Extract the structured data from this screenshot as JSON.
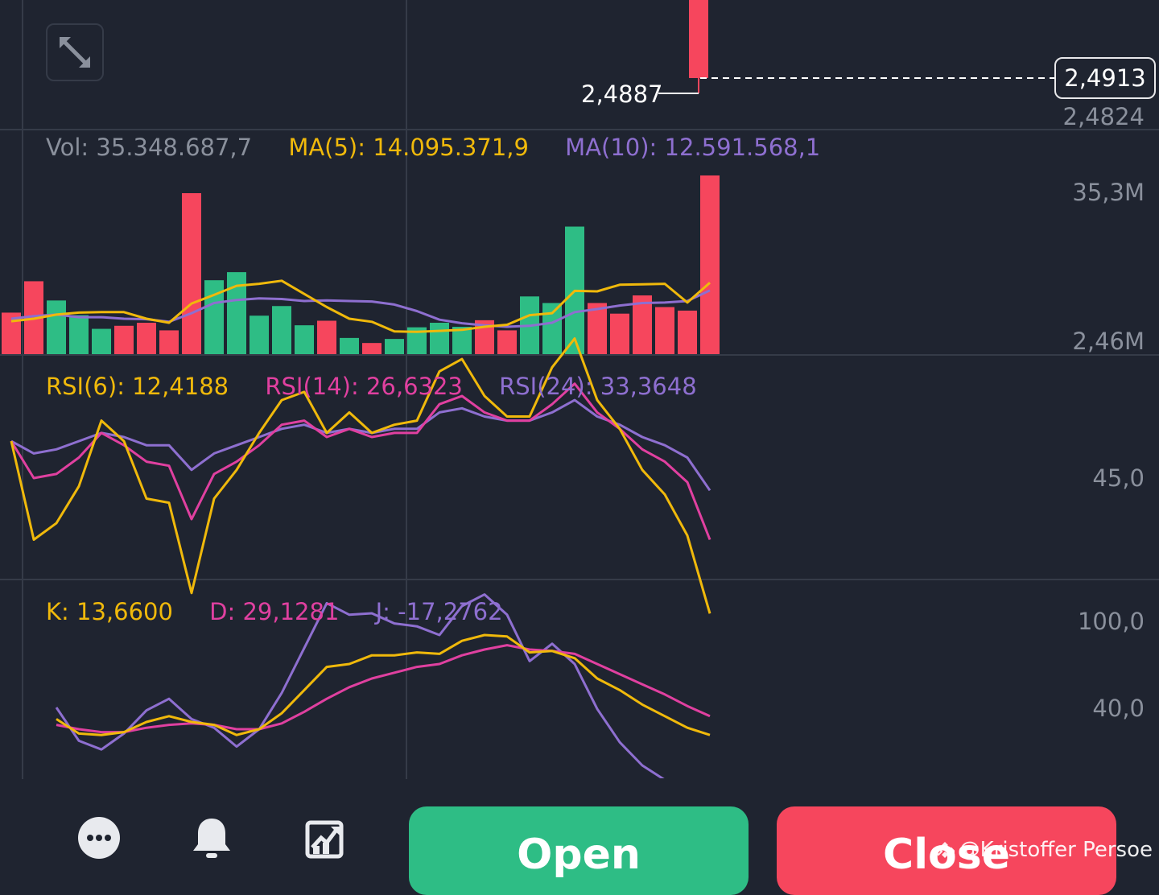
{
  "colors": {
    "background": "#1f2430",
    "grid": "#353b48",
    "up": "#f6465d",
    "down": "#2ebd85",
    "yellow": "#f0b90b",
    "pink": "#e040a0",
    "purple": "#8e6fd0",
    "axis_text": "#8a909c"
  },
  "price": {
    "last_candle_low_label": "2,4887",
    "current_price_tag": "2,4913",
    "axis_label": "2,4824"
  },
  "volume": {
    "legend": {
      "vol": "Vol: 35.348.687,7",
      "ma5": "MA(5): 14.095.371,9",
      "ma10": "MA(10): 12.591.568,1"
    },
    "axis_top": "35,3M",
    "axis_bottom": "2,46M"
  },
  "rsi": {
    "legend": {
      "rsi6": "RSI(6): 12,4188",
      "rsi14": "RSI(14): 26,6323",
      "rsi24": "RSI(24): 33,3648"
    },
    "axis": "45,0"
  },
  "kdj": {
    "legend": {
      "k": "K: 13,6600",
      "d": "D: 29,1281",
      "j": "J: -17,2762"
    },
    "axis_top": "100,0",
    "axis_mid": "40,0"
  },
  "chart_data": {
    "type": "bar",
    "volume_bars": [
      {
        "v": 8.2,
        "up": true
      },
      {
        "v": 14.4,
        "up": true
      },
      {
        "v": 10.6,
        "up": false
      },
      {
        "v": 7.7,
        "up": false
      },
      {
        "v": 5.0,
        "up": false
      },
      {
        "v": 5.6,
        "up": true
      },
      {
        "v": 6.2,
        "up": true
      },
      {
        "v": 4.7,
        "up": true
      },
      {
        "v": 31.8,
        "up": true
      },
      {
        "v": 14.6,
        "up": false
      },
      {
        "v": 16.2,
        "up": false
      },
      {
        "v": 7.6,
        "up": false
      },
      {
        "v": 9.5,
        "up": false
      },
      {
        "v": 5.7,
        "up": false
      },
      {
        "v": 6.6,
        "up": true
      },
      {
        "v": 3.2,
        "up": false
      },
      {
        "v": 2.2,
        "up": true
      },
      {
        "v": 3.0,
        "up": false
      },
      {
        "v": 5.3,
        "up": false
      },
      {
        "v": 6.2,
        "up": false
      },
      {
        "v": 5.4,
        "up": false
      },
      {
        "v": 6.7,
        "up": true
      },
      {
        "v": 4.7,
        "up": true
      },
      {
        "v": 11.4,
        "up": false
      },
      {
        "v": 10.1,
        "up": false
      },
      {
        "v": 25.2,
        "up": false
      },
      {
        "v": 10.1,
        "up": true
      },
      {
        "v": 8.0,
        "up": true
      },
      {
        "v": 11.6,
        "up": true
      },
      {
        "v": 9.3,
        "up": true
      },
      {
        "v": 8.6,
        "up": true
      },
      {
        "v": 35.3,
        "up": true
      }
    ],
    "volume_ma5": [
      6.5,
      7.0,
      7.8,
      8.2,
      8.3,
      8.3,
      7.0,
      6.2,
      10.0,
      11.7,
      13.5,
      13.9,
      14.5,
      11.9,
      9.3,
      7.0,
      6.4,
      4.5,
      4.4,
      4.6,
      4.8,
      5.4,
      5.8,
      7.7,
      8.1,
      12.5,
      12.4,
      13.7,
      13.8,
      13.9,
      10.2,
      14.1
    ],
    "volume_ma10": [
      7.0,
      7.5,
      7.8,
      7.3,
      7.3,
      7.0,
      6.9,
      6.4,
      8.1,
      10.1,
      10.7,
      11.0,
      10.9,
      10.5,
      10.6,
      10.5,
      10.4,
      9.8,
      8.5,
      6.8,
      6.1,
      5.7,
      5.4,
      5.6,
      6.2,
      8.3,
      8.9,
      9.6,
      10.1,
      10.2,
      10.5,
      12.6
    ],
    "rsi6": [
      54,
      30,
      34,
      43,
      59,
      54,
      40,
      39,
      17,
      40,
      47,
      56,
      64,
      66,
      56,
      61,
      56,
      58,
      59,
      71,
      74,
      65,
      60,
      60,
      72,
      79,
      64,
      57,
      47,
      41,
      31,
      12
    ],
    "rsi14": [
      54,
      45,
      46,
      50,
      56,
      53,
      49,
      48,
      35,
      46,
      49,
      53,
      58,
      59,
      55,
      57,
      55,
      56,
      56,
      63,
      65,
      61,
      59,
      59,
      63,
      68,
      61,
      57,
      52,
      49,
      44,
      30
    ],
    "rsi24": [
      54,
      51,
      52,
      54,
      56,
      55,
      53,
      53,
      47,
      51,
      53,
      55,
      57,
      58,
      56,
      57,
      56,
      57,
      57,
      61,
      62,
      60,
      59,
      59,
      61,
      64,
      60,
      58,
      55,
      53,
      50,
      42
    ],
    "kdj_k": [
      32,
      22,
      21,
      23,
      30,
      34,
      30,
      28,
      21,
      25,
      36,
      52,
      68,
      70,
      76,
      76,
      78,
      77,
      86,
      90,
      89,
      78,
      79,
      74,
      60,
      52,
      42,
      34,
      26,
      21
    ],
    "kdj_d": [
      28,
      25,
      23,
      23,
      26,
      28,
      29,
      28,
      25,
      25,
      29,
      37,
      46,
      54,
      60,
      64,
      68,
      70,
      76,
      80,
      83,
      80,
      79,
      77,
      70,
      63,
      56,
      49,
      41,
      34
    ],
    "kdj_j": [
      40,
      17,
      11,
      22,
      38,
      46,
      32,
      26,
      13,
      25,
      50,
      81,
      112,
      104,
      105,
      98,
      96,
      90,
      110,
      118,
      104,
      72,
      84,
      70,
      39,
      16,
      0,
      -10,
      -20,
      -17
    ]
  },
  "toolbar": {
    "open_label": "Open",
    "close_label": "Close"
  },
  "watermark": "@Kristoffer Persoe"
}
